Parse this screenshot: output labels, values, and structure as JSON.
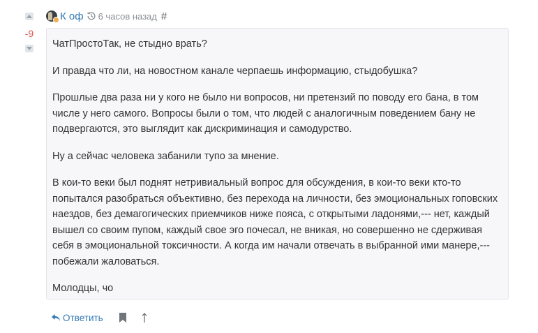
{
  "vote": {
    "score": "-9",
    "upvote_icon": "triangle-up-icon",
    "downvote_icon": "triangle-down-icon"
  },
  "header": {
    "author": "К оф",
    "time": "6 часов назад",
    "permalink": "#",
    "history_icon": "history-icon"
  },
  "comment": {
    "paragraphs": [
      "ЧатПростоТак, не стыдно врать?",
      "И правда что ли, на новостном канале черпаешь информацию, стыдобушка?",
      "Прошлые два раза ни у кого не было ни вопросов, ни претензий по поводу его бана, в том числе у него самого. Вопросы были о том, что людей с аналогичным поведением бану не подвергаются, это выглядит как дискриминация и самодурство.",
      "Ну а сейчас человека забанили тупо за мнение.",
      "В кои-то веки был поднят нетривиальный вопрос для обсуждения, в кои-то веки кто-то попытался разобраться объективно, без перехода на личности, без эмоциональных гоповских наездов, без демагогических приемчиков ниже пояса, с открытыми ладонями,--- нет, каждый вышел со своим пупом, каждый свое эго почесал, не вникая, но совершенно не сдерживая себя в эмоциональной токсичности. А когда им начали отвечать в выбранной ими манере,--- побежали жаловаться.",
      "Молодцы, чо"
    ]
  },
  "actions": {
    "reply_label": "Ответить",
    "reply_icon": "reply-arrow-icon",
    "bookmark_icon": "bookmark-icon",
    "scroll_up_icon": "arrow-up-icon"
  },
  "colors": {
    "link": "#337ab7",
    "score_negative": "#d9534f",
    "comment_bg": "#f7f7f9",
    "comment_border": "#e3e4e8",
    "text": "#333333"
  }
}
